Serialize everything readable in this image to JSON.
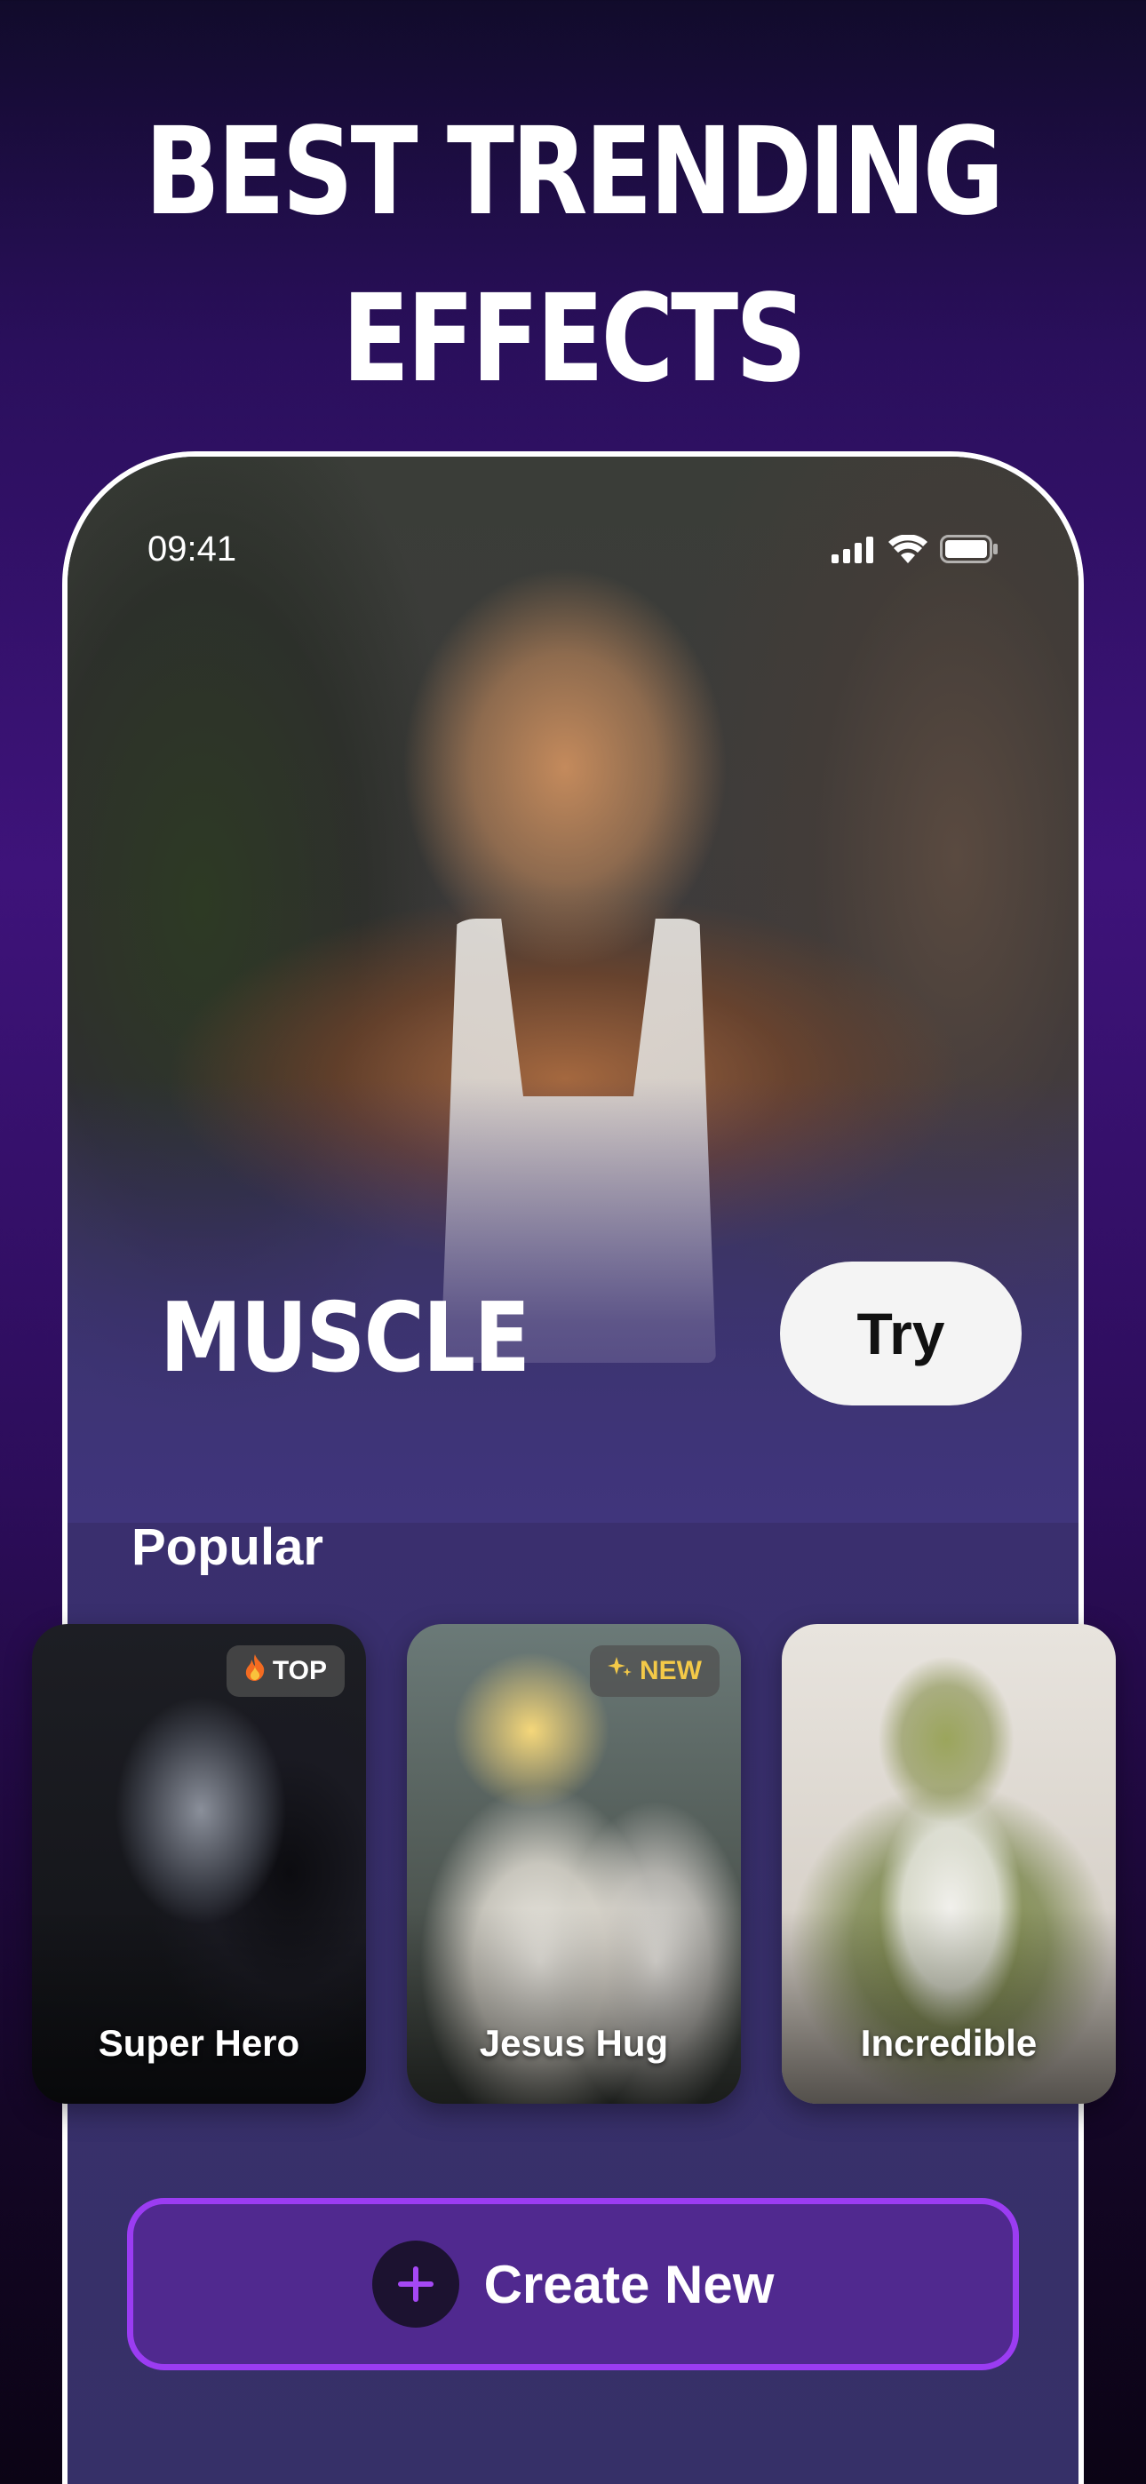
{
  "headline": {
    "line1": "BEST TRENDING",
    "line2": "EFFECTS"
  },
  "status_bar": {
    "time": "09:41",
    "icons": [
      "signal-icon",
      "wifi-icon",
      "battery-icon"
    ]
  },
  "hero": {
    "title": "MUSCLE",
    "try_label": "Try"
  },
  "popular": {
    "section_label": "Popular",
    "cards": [
      {
        "label": "Super Hero",
        "badge": "TOP",
        "badge_icon": "fire-icon"
      },
      {
        "label": "Jesus Hug",
        "badge": "NEW",
        "badge_icon": "sparkle-icon"
      },
      {
        "label": "Incredible"
      }
    ]
  },
  "create_button": {
    "label": "Create New",
    "icon": "plus-icon"
  },
  "colors": {
    "accent_purple": "#9b3cf2",
    "button_fill": "#50298f",
    "try_button": "#f4f4f4",
    "badge_new_text": "#f3c948"
  }
}
